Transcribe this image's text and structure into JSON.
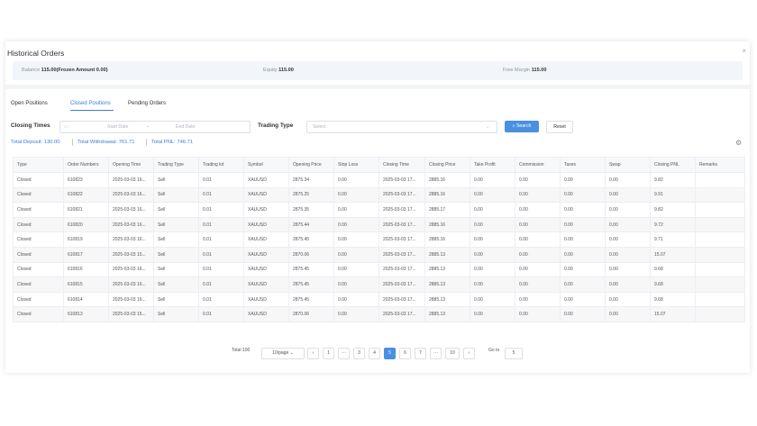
{
  "modal": {
    "title": "Historical Orders",
    "close_glyph": "×"
  },
  "balance": {
    "balance_label": "Balance",
    "balance_value": "115.00(Frozen Amount 0.00)",
    "equity_label": "Equity",
    "equity_value": "115.00",
    "free_margin_label": "Free Margin",
    "free_margin_value": "115.00"
  },
  "tabs": [
    "Open Positions",
    "Closed Positions",
    "Pending Orders"
  ],
  "filters": {
    "closing_times_label": "Closing Times",
    "start_placeholder": "Start Date",
    "range_sep": "-",
    "end_placeholder": "End Date",
    "trading_type_label": "Trading Type",
    "select_placeholder": "Select",
    "search_label": "Search",
    "reset_label": "Reset"
  },
  "totals": {
    "deposit": "Total Deposit: 130.00",
    "withdrawal": "Total Withdrawal: 761.71",
    "pnl": "Total PNL: 746.71"
  },
  "table": {
    "headers": [
      "Type",
      "Order Numbers",
      "Opening Time",
      "Trading Type",
      "Trading lot",
      "Symbol",
      "Opening Price",
      "Stop Loss",
      "Closing Time",
      "Closing Price",
      "Take Profit",
      "Commission",
      "Taxes",
      "Swap",
      "Closing PNL",
      "Remarks"
    ],
    "rows": [
      [
        "Closed",
        "610823",
        "2025-03-03 16...",
        "Sell",
        "0.01",
        "XAUUSD",
        "2875.34",
        "0.00",
        "2025-03-03 17...",
        "2885.16",
        "0.00",
        "0.00",
        "0.00",
        "0.00",
        "9.82",
        ""
      ],
      [
        "Closed",
        "610822",
        "2025-03-03 16...",
        "Sell",
        "0.01",
        "XAUUSD",
        "2875.25",
        "0.00",
        "2025-03-03 17...",
        "2885.16",
        "0.00",
        "0.00",
        "0.00",
        "0.00",
        "9.91",
        ""
      ],
      [
        "Closed",
        "610821",
        "2025-03-03 16...",
        "Sell",
        "0.01",
        "XAUUSD",
        "2875.35",
        "0.00",
        "2025-03-03 17...",
        "2885.17",
        "0.00",
        "0.00",
        "0.00",
        "0.00",
        "9.82",
        ""
      ],
      [
        "Closed",
        "610820",
        "2025-03-03 16...",
        "Sell",
        "0.01",
        "XAUUSD",
        "2875.44",
        "0.00",
        "2025-03-03 17...",
        "2885.16",
        "0.00",
        "0.00",
        "0.00",
        "0.00",
        "9.72",
        ""
      ],
      [
        "Closed",
        "610819",
        "2025-03-03 16...",
        "Sell",
        "0.01",
        "XAUUSD",
        "2875.45",
        "0.00",
        "2025-03-03 17...",
        "2885.16",
        "0.00",
        "0.00",
        "0.00",
        "0.00",
        "9.71",
        ""
      ],
      [
        "Closed",
        "610817",
        "2025-03-03 15...",
        "Sell",
        "0.01",
        "XAUUSD",
        "2870.06",
        "0.00",
        "2025-03-03 17...",
        "2885.13",
        "0.00",
        "0.00",
        "0.00",
        "0.00",
        "15.07",
        ""
      ],
      [
        "Closed",
        "610816",
        "2025-03-03 16...",
        "Sell",
        "0.01",
        "XAUUSD",
        "2875.45",
        "0.00",
        "2025-03-03 17...",
        "2885.13",
        "0.00",
        "0.00",
        "0.00",
        "0.00",
        "9.68",
        ""
      ],
      [
        "Closed",
        "610815",
        "2025-03-03 16...",
        "Sell",
        "0.01",
        "XAUUSD",
        "2875.45",
        "0.00",
        "2025-03-03 17...",
        "2885.13",
        "0.00",
        "0.00",
        "0.00",
        "0.00",
        "9.68",
        ""
      ],
      [
        "Closed",
        "610814",
        "2025-03-03 16...",
        "Sell",
        "0.01",
        "XAUUSD",
        "2875.45",
        "0.00",
        "2025-03-03 17...",
        "2885.13",
        "0.00",
        "0.00",
        "0.00",
        "0.00",
        "9.68",
        ""
      ],
      [
        "Closed",
        "610813",
        "2025-03-03 15...",
        "Sell",
        "0.01",
        "XAUUSD",
        "2870.06",
        "0.00",
        "2025-03-03 17...",
        "2885.13",
        "0.00",
        "0.00",
        "0.00",
        "0.00",
        "15.07",
        ""
      ]
    ]
  },
  "pagination": {
    "total": "Total 100",
    "page_size": "10/page",
    "pages": [
      "‹",
      "1",
      "···",
      "3",
      "4",
      "5",
      "6",
      "7",
      "···",
      "10",
      "›"
    ],
    "active": "5",
    "goto_label": "Go to",
    "goto_value": "5"
  },
  "icons": {
    "calendar": "calendar-icon",
    "search": "search-icon",
    "chevron": "chevron-down-icon",
    "gear": "gear-icon"
  },
  "colors": {
    "accent": "#3b7ddd",
    "button": "#4a90e2"
  }
}
